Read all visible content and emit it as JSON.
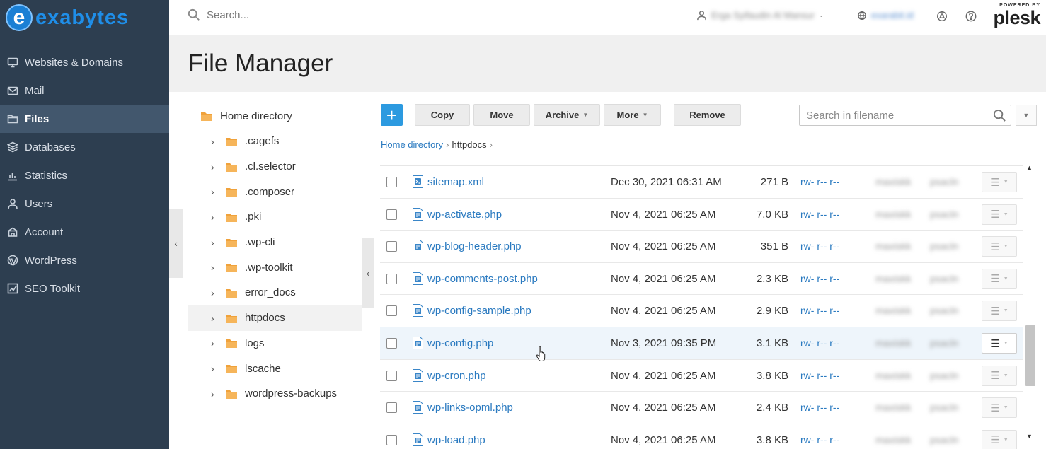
{
  "brand": {
    "logo_letter": "e",
    "logo_text": "exabytes"
  },
  "sidebar": {
    "items": [
      {
        "label": "Websites & Domains",
        "icon": "monitor-icon",
        "active": false
      },
      {
        "label": "Mail",
        "icon": "mail-icon",
        "active": false
      },
      {
        "label": "Files",
        "icon": "folder-icon",
        "active": true
      },
      {
        "label": "Databases",
        "icon": "database-icon",
        "active": false
      },
      {
        "label": "Statistics",
        "icon": "bar-chart-icon",
        "active": false
      },
      {
        "label": "Users",
        "icon": "user-icon",
        "active": false
      },
      {
        "label": "Account",
        "icon": "account-icon",
        "active": false
      },
      {
        "label": "WordPress",
        "icon": "wordpress-icon",
        "active": false
      },
      {
        "label": "SEO Toolkit",
        "icon": "seo-chart-icon",
        "active": false
      }
    ]
  },
  "topbar": {
    "search_placeholder": "Search...",
    "user_name": "Erga Syifaudin Al Mansur",
    "subscription": "exarabit.id",
    "plesk_powered": "POWERED BY",
    "plesk_name": "plesk"
  },
  "page": {
    "title": "File Manager"
  },
  "tree": {
    "root": "Home directory",
    "items": [
      {
        "name": ".cagefs",
        "active": false
      },
      {
        "name": ".cl.selector",
        "active": false
      },
      {
        "name": ".composer",
        "active": false
      },
      {
        "name": ".pki",
        "active": false
      },
      {
        "name": ".wp-cli",
        "active": false
      },
      {
        "name": ".wp-toolkit",
        "active": false
      },
      {
        "name": "error_docs",
        "active": false
      },
      {
        "name": "httpdocs",
        "active": true
      },
      {
        "name": "logs",
        "active": false
      },
      {
        "name": "lscache",
        "active": false
      },
      {
        "name": "wordpress-backups",
        "active": false
      }
    ]
  },
  "toolbar": {
    "add_label": "+",
    "copy_label": "Copy",
    "move_label": "Move",
    "archive_label": "Archive",
    "more_label": "More",
    "remove_label": "Remove",
    "filename_search_placeholder": "Search in filename"
  },
  "breadcrumb": {
    "root": "Home directory",
    "current": "httpdocs"
  },
  "files": [
    {
      "name": "sitemap.xml",
      "type": "xml",
      "date": "Dec 30, 2021 06:31 AM",
      "size": "271 B",
      "perms": "rw- r-- r--",
      "user": "maxiskk",
      "group": "psacln"
    },
    {
      "name": "wp-activate.php",
      "type": "php",
      "date": "Nov 4, 2021 06:25 AM",
      "size": "7.0 KB",
      "perms": "rw- r-- r--",
      "user": "maxiskk",
      "group": "psacln"
    },
    {
      "name": "wp-blog-header.php",
      "type": "php",
      "date": "Nov 4, 2021 06:25 AM",
      "size": "351 B",
      "perms": "rw- r-- r--",
      "user": "maxiskk",
      "group": "psacln"
    },
    {
      "name": "wp-comments-post.php",
      "type": "php",
      "date": "Nov 4, 2021 06:25 AM",
      "size": "2.3 KB",
      "perms": "rw- r-- r--",
      "user": "maxiskk",
      "group": "psacln"
    },
    {
      "name": "wp-config-sample.php",
      "type": "php",
      "date": "Nov 4, 2021 06:25 AM",
      "size": "2.9 KB",
      "perms": "rw- r-- r--",
      "user": "maxiskk",
      "group": "psacln"
    },
    {
      "name": "wp-config.php",
      "type": "php",
      "date": "Nov 3, 2021 09:35 PM",
      "size": "3.1 KB",
      "perms": "rw- r-- r--",
      "user": "maxiskk",
      "group": "psacln",
      "hover": true
    },
    {
      "name": "wp-cron.php",
      "type": "php",
      "date": "Nov 4, 2021 06:25 AM",
      "size": "3.8 KB",
      "perms": "rw- r-- r--",
      "user": "maxiskk",
      "group": "psacln"
    },
    {
      "name": "wp-links-opml.php",
      "type": "php",
      "date": "Nov 4, 2021 06:25 AM",
      "size": "2.4 KB",
      "perms": "rw- r-- r--",
      "user": "maxiskk",
      "group": "psacln"
    },
    {
      "name": "wp-load.php",
      "type": "php",
      "date": "Nov 4, 2021 06:25 AM",
      "size": "3.8 KB",
      "perms": "rw- r-- r--",
      "user": "maxiskk",
      "group": "psacln"
    }
  ],
  "colors": {
    "sidebar_bg": "#2d3e50",
    "sidebar_active": "#42576d",
    "accent": "#2c9ae0",
    "link": "#2a7ac0",
    "folder": "#f0a23b"
  }
}
